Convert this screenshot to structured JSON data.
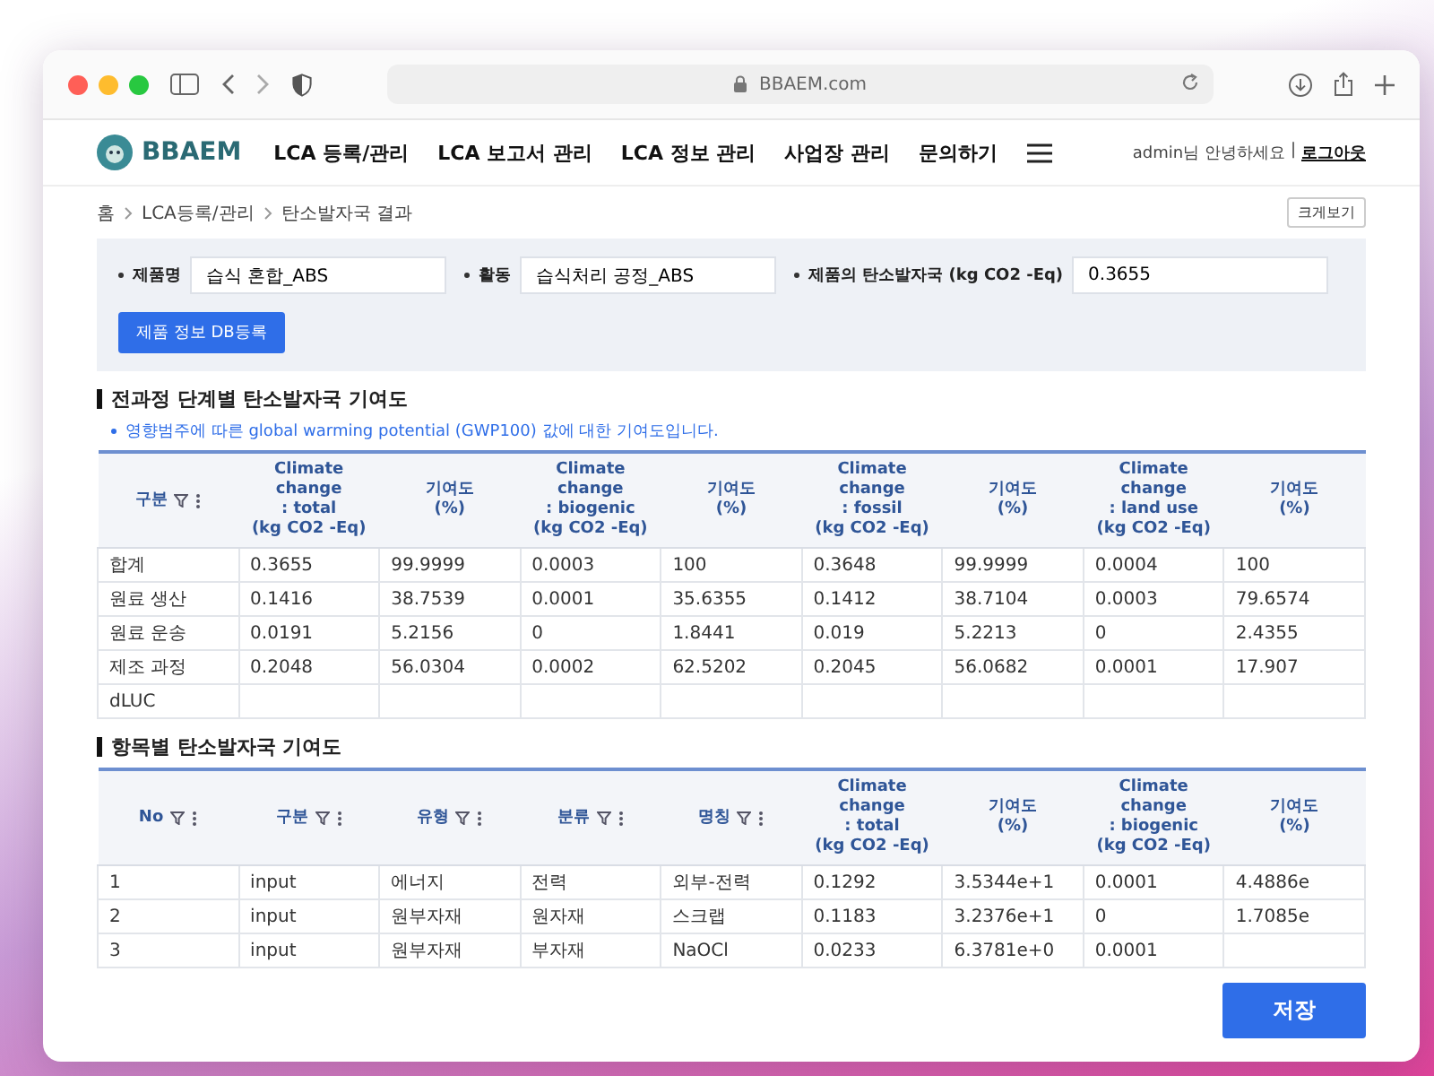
{
  "browser": {
    "address": "BBAEM.com"
  },
  "site": {
    "logo": "BBAEM",
    "nav": [
      "LCA 등록/관리",
      "LCA 보고서 관리",
      "LCA 정보 관리",
      "사업장 관리",
      "문의하기"
    ],
    "user": "admin",
    "greeting": "님 안녕하세요",
    "separator": "|",
    "logout": "로그아웃"
  },
  "breadcrumb": [
    "홈",
    "LCA등록/관리",
    "탄소발자국 결과"
  ],
  "enlarge_button": "크게보기",
  "filters": [
    {
      "label": "제품명",
      "value": "습식 혼합_ABS"
    },
    {
      "label": "활동",
      "value": "습식처리 공정_ABS"
    },
    {
      "label": "제품의 탄소발자국 (kg CO2 -Eq)",
      "value": "0.3655"
    }
  ],
  "register_button": "제품 정보 DB등록",
  "sections": [
    {
      "title": "전과정 단계별 탄소발자국 기여도",
      "note": "영향범주에 따른 global warming potential (GWP100) 값에 대한 기여도입니다.",
      "columns": [
        {
          "label": "구분",
          "filter": true
        },
        {
          "label": "Climate change\n: total\n(kg CO2 -Eq)",
          "filter": false
        },
        {
          "label": "기여도\n(%)",
          "filter": false
        },
        {
          "label": "Climate change\n: biogenic\n(kg CO2 -Eq)",
          "filter": false
        },
        {
          "label": "기여도\n(%)",
          "filter": false
        },
        {
          "label": "Climate change\n: fossil\n(kg CO2 -Eq)",
          "filter": false
        },
        {
          "label": "기여도\n(%)",
          "filter": false
        },
        {
          "label": "Climate change\n: land use\n(kg CO2 -Eq)",
          "filter": false
        },
        {
          "label": "기여도\n(%)",
          "filter": false
        }
      ],
      "rows": [
        [
          "합계",
          "0.3655",
          "99.9999",
          "0.0003",
          "100",
          "0.3648",
          "99.9999",
          "0.0004",
          "100"
        ],
        [
          "원료 생산",
          "0.1416",
          "38.7539",
          "0.0001",
          "35.6355",
          "0.1412",
          "38.7104",
          "0.0003",
          "79.6574"
        ],
        [
          "원료 운송",
          "0.0191",
          "5.2156",
          "0",
          "1.8441",
          "0.019",
          "5.2213",
          "0",
          "2.4355"
        ],
        [
          "제조 과정",
          "0.2048",
          "56.0304",
          "0.0002",
          "62.5202",
          "0.2045",
          "56.0682",
          "0.0001",
          "17.907"
        ],
        [
          "dLUC"
        ]
      ]
    },
    {
      "title": "항목별 탄소발자국 기여도",
      "columns": [
        {
          "label": "No",
          "filter": true
        },
        {
          "label": "구분",
          "filter": true
        },
        {
          "label": "유형",
          "filter": true
        },
        {
          "label": "분류",
          "filter": true
        },
        {
          "label": "명칭",
          "filter": true
        },
        {
          "label": "Climate change\n: total\n(kg CO2 -Eq)",
          "filter": false
        },
        {
          "label": "기여도\n(%)",
          "filter": false
        },
        {
          "label": "Climate change\n: biogenic\n(kg CO2 -Eq)",
          "filter": false
        },
        {
          "label": "기여도\n(%)",
          "filter": false
        }
      ],
      "rows": [
        [
          "1",
          "input",
          "에너지",
          "전력",
          "외부-전력",
          "0.1292",
          "3.5344e+1",
          "0.0001",
          "4.4886e"
        ],
        [
          "2",
          "input",
          "원부자재",
          "원자재",
          "스크랩",
          "0.1183",
          "3.2376e+1",
          "0",
          "1.7085e"
        ],
        [
          "3",
          "input",
          "원부자재",
          "부자재",
          "NaOCl",
          "0.0233",
          "6.3781e+0",
          "0.0001"
        ]
      ]
    }
  ],
  "save_button": "저장"
}
